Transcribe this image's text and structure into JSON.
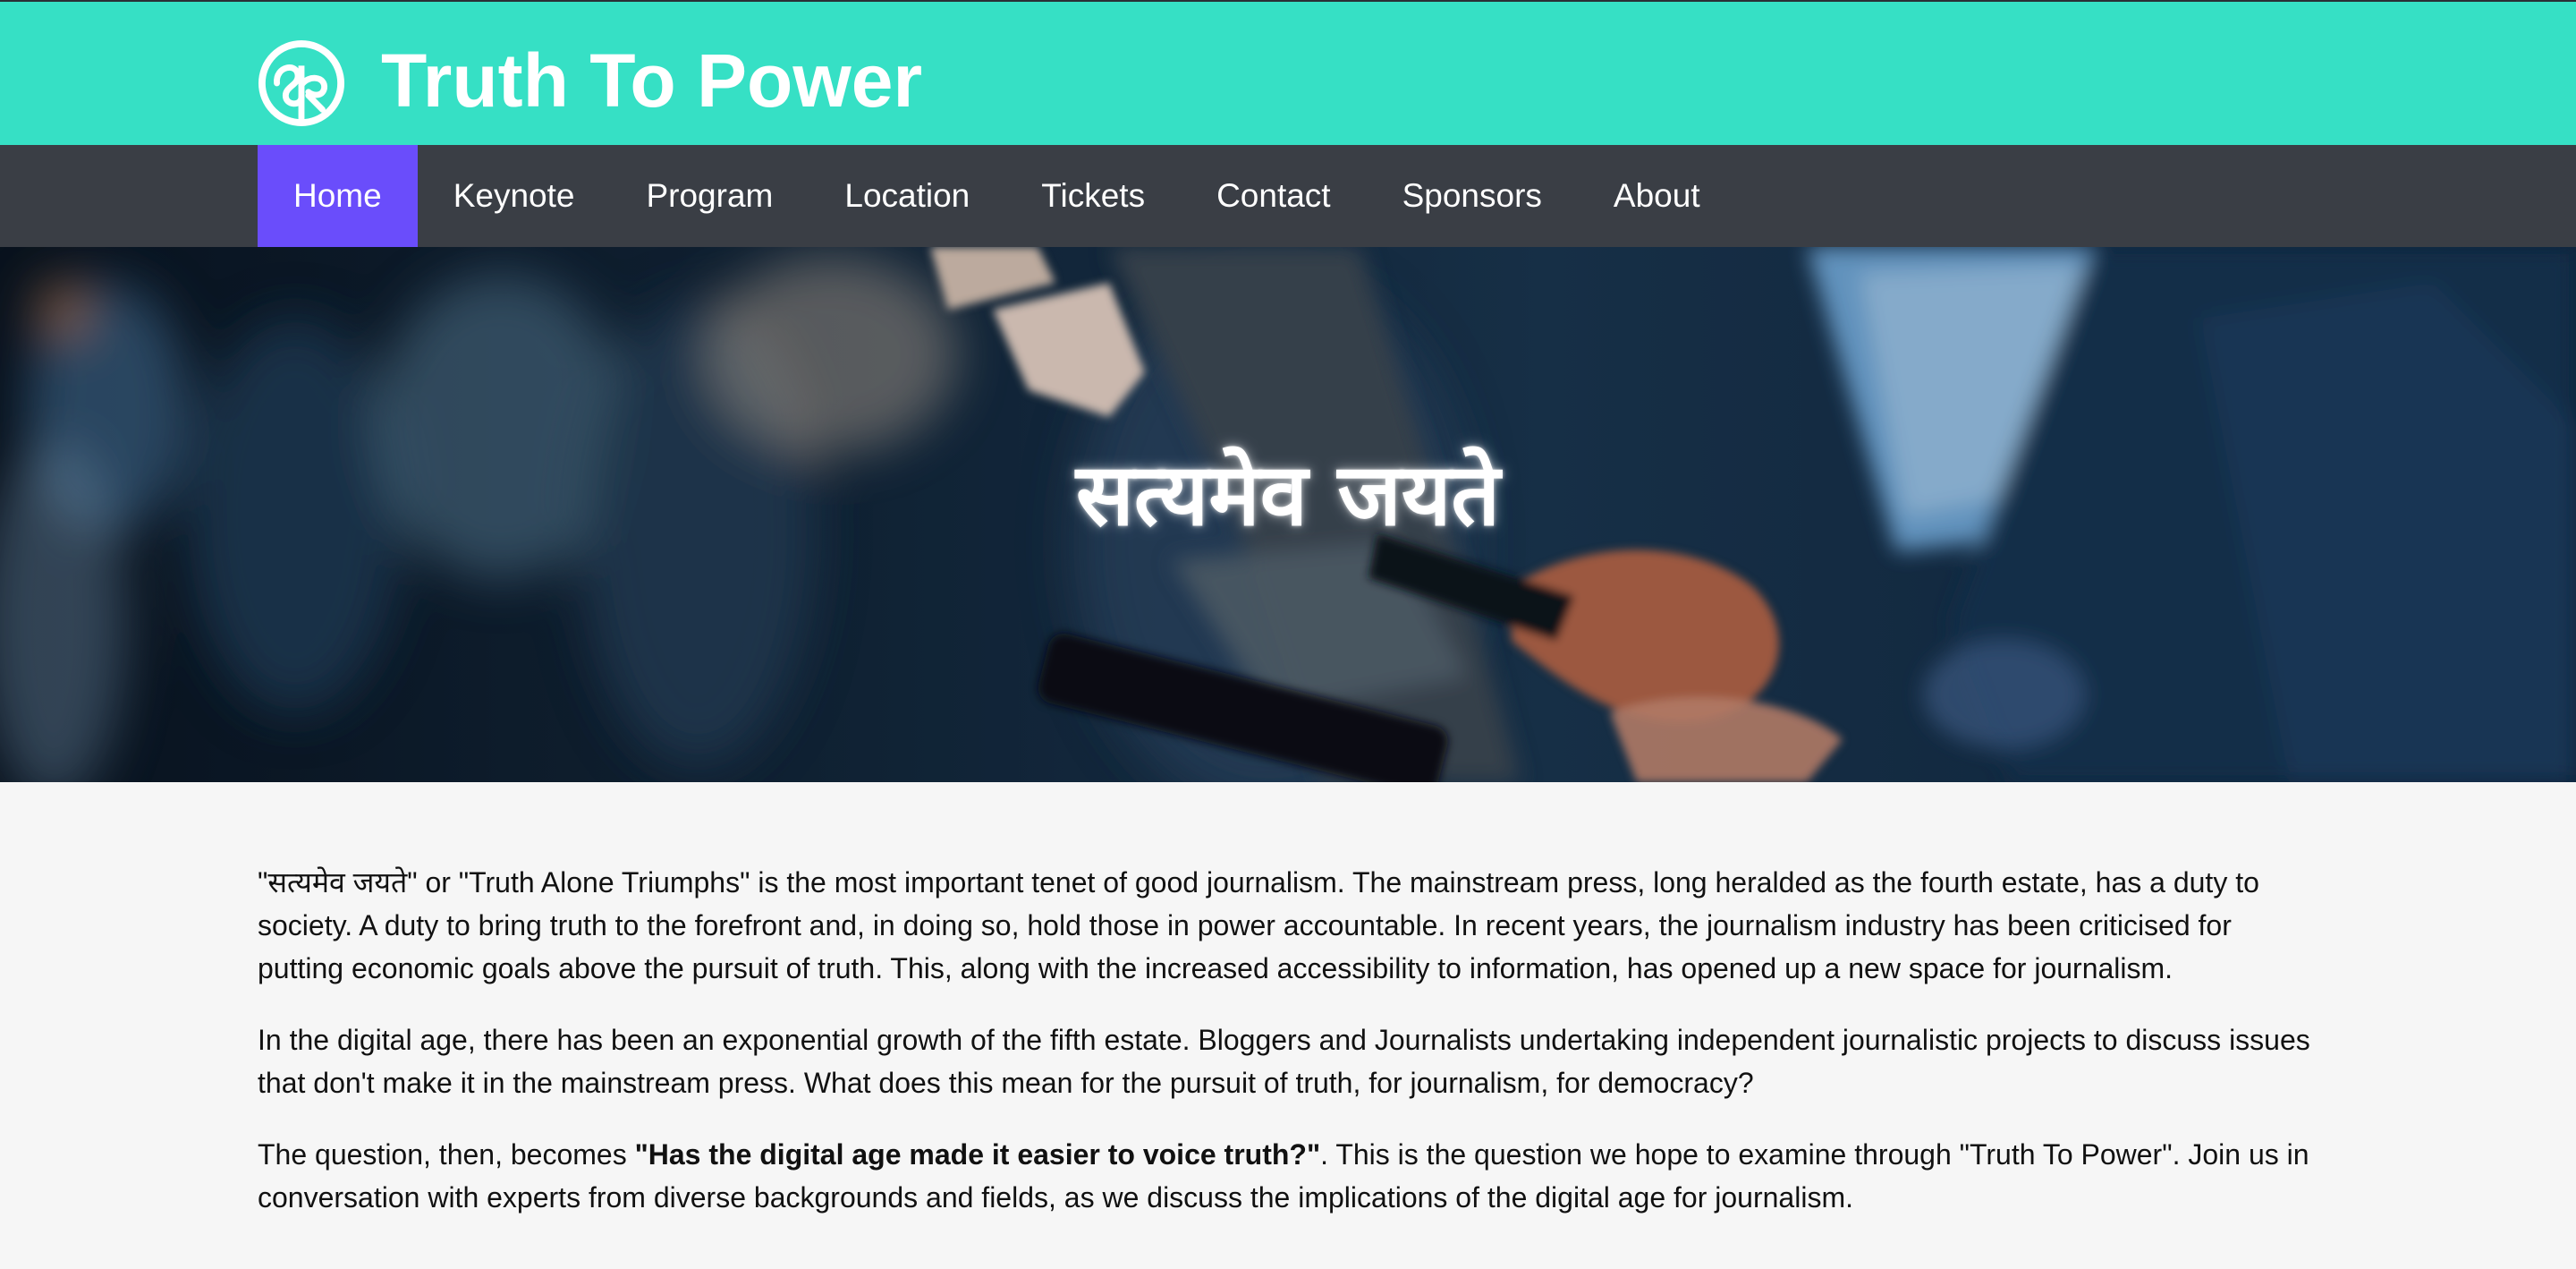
{
  "header": {
    "site_title": "Truth To Power",
    "logo_icon": "devanagari-emblem-icon"
  },
  "colors": {
    "header_bg": "#36e0c5",
    "nav_bg": "#3a3e45",
    "nav_active": "#6a4dfb",
    "page_bg": "#f6f6f6"
  },
  "nav": {
    "items": [
      {
        "label": "Home",
        "active": true
      },
      {
        "label": "Keynote"
      },
      {
        "label": "Program"
      },
      {
        "label": "Location"
      },
      {
        "label": "Tickets"
      },
      {
        "label": "Contact"
      },
      {
        "label": "Sponsors"
      },
      {
        "label": "About"
      }
    ]
  },
  "hero": {
    "title": "सत्यमेव जयते"
  },
  "content": {
    "p1": "\"सत्यमेव जयते\" or \"Truth Alone Triumphs\" is the most important tenet of good journalism. The mainstream press, long heralded as the fourth estate, has a duty to society. A duty to bring truth to the forefront and, in doing so, hold those in power accountable. In recent years, the journalism industry has been criticised for putting economic goals above the pursuit of truth. This, along with the increased accessibility to information, has opened up a new space for journalism.",
    "p2": "In the digital age, there has been an exponential growth of the fifth estate. Bloggers and Journalists undertaking independent journalistic projects to discuss issues that don't make it in the mainstream press. What does this mean for the pursuit of truth, for journalism, for democracy?",
    "p3_before": "The question, then, becomes ",
    "p3_bold": "\"Has the digital age made it easier to voice truth?\"",
    "p3_after": ". This is the question we hope to examine through \"Truth To Power\". Join us in conversation with experts from diverse backgrounds and fields, as we discuss the implications of the digital age for journalism."
  }
}
